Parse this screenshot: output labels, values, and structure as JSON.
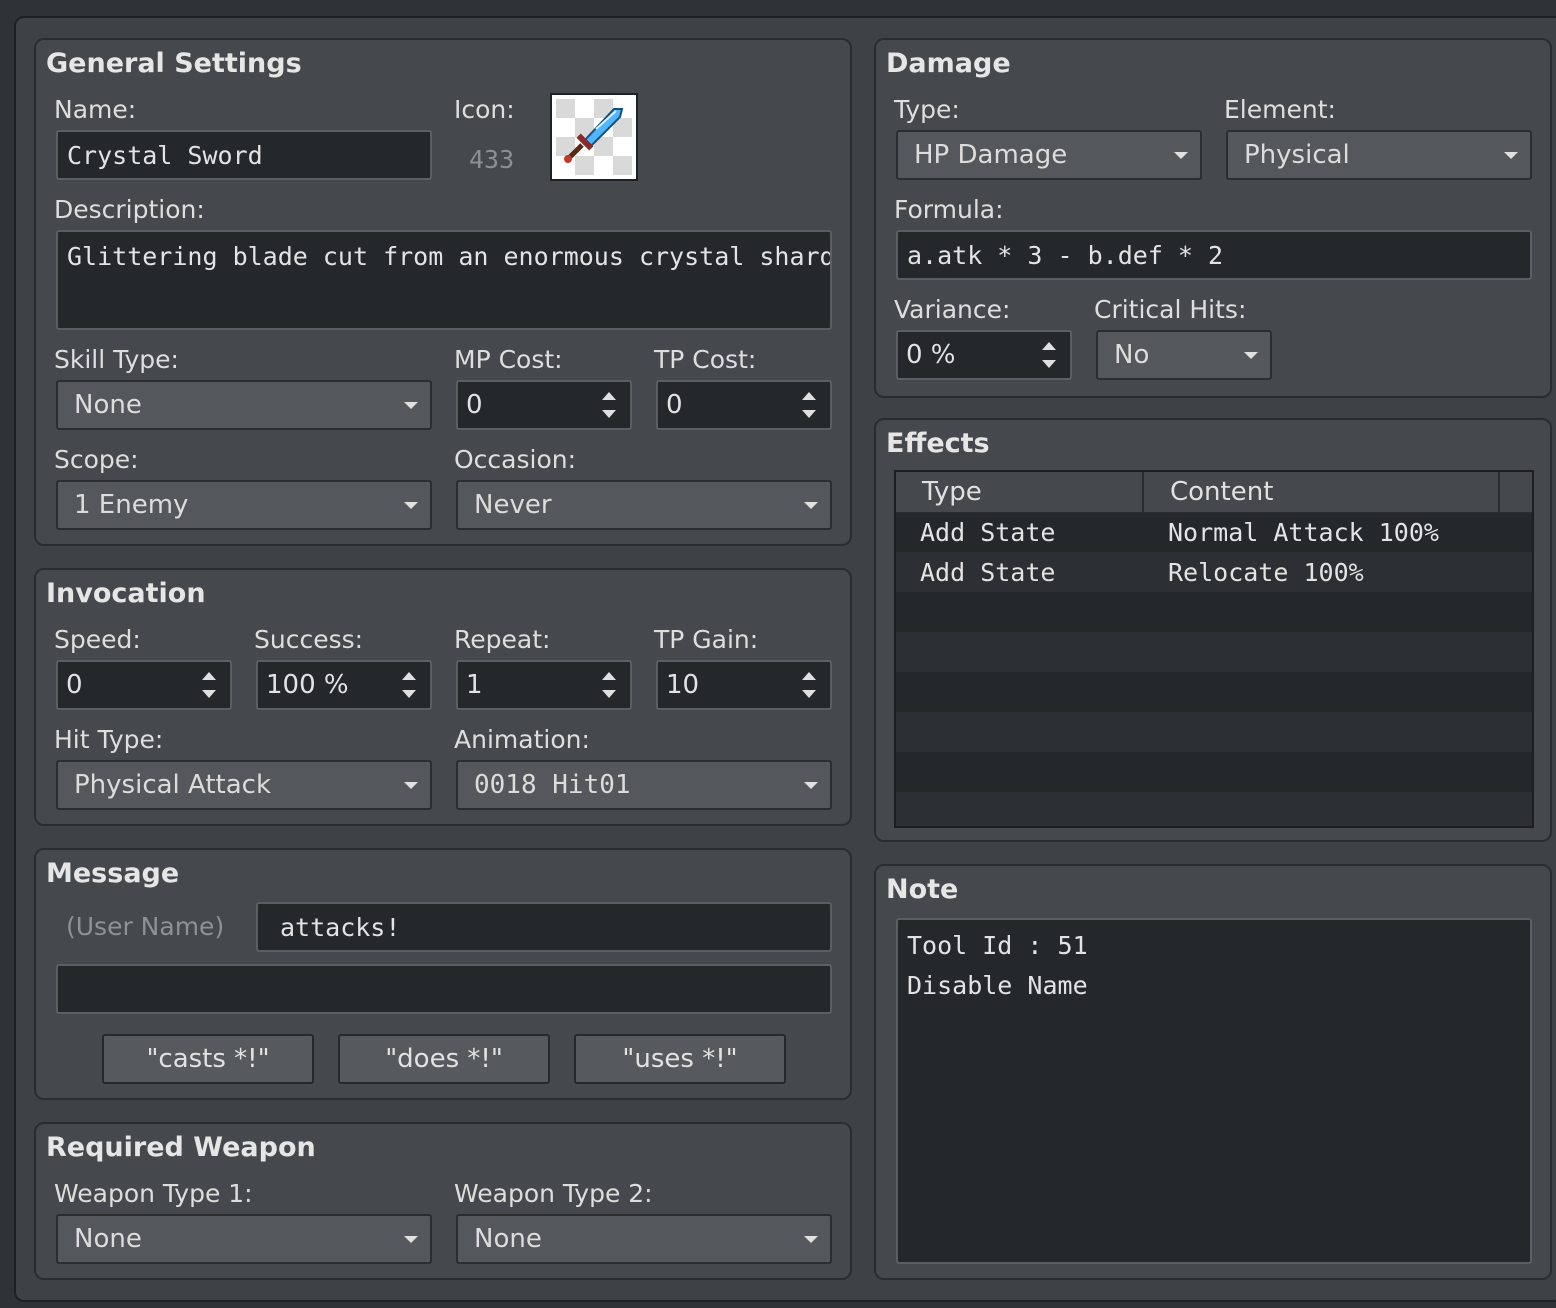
{
  "general": {
    "title": "General Settings",
    "name_label": "Name:",
    "name_value": "Crystal Sword",
    "icon_label": "Icon:",
    "icon_index": "433",
    "icon_name": "sword-icon",
    "description_label": "Description:",
    "description_value": "Glittering blade cut from an enormous crystal shard.",
    "skill_type_label": "Skill Type:",
    "skill_type_value": "None",
    "mp_cost_label": "MP Cost:",
    "mp_cost_value": "0",
    "tp_cost_label": "TP Cost:",
    "tp_cost_value": "0",
    "scope_label": "Scope:",
    "scope_value": "1 Enemy",
    "occasion_label": "Occasion:",
    "occasion_value": "Never"
  },
  "invocation": {
    "title": "Invocation",
    "speed_label": "Speed:",
    "speed_value": "0",
    "success_label": "Success:",
    "success_value": "100 %",
    "repeat_label": "Repeat:",
    "repeat_value": "1",
    "tp_gain_label": "TP Gain:",
    "tp_gain_value": "10",
    "hit_type_label": "Hit Type:",
    "hit_type_value": "Physical Attack",
    "animation_label": "Animation:",
    "animation_value": "0018 Hit01"
  },
  "message": {
    "title": "Message",
    "user_name_label": "(User Name)",
    "line1_value": "attacks!",
    "line2_value": "",
    "buttons": [
      "\"casts *!\"",
      "\"does *!\"",
      "\"uses *!\""
    ]
  },
  "required_weapon": {
    "title": "Required Weapon",
    "type1_label": "Weapon Type 1:",
    "type1_value": "None",
    "type2_label": "Weapon Type 2:",
    "type2_value": "None"
  },
  "damage": {
    "title": "Damage",
    "type_label": "Type:",
    "type_value": "HP Damage",
    "element_label": "Element:",
    "element_value": "Physical",
    "formula_label": "Formula:",
    "formula_value": "a.atk * 3 - b.def * 2",
    "variance_label": "Variance:",
    "variance_value": "0 %",
    "critical_label": "Critical Hits:",
    "critical_value": "No"
  },
  "effects": {
    "title": "Effects",
    "columns": [
      "Type",
      "Content"
    ],
    "rows": [
      {
        "type": "Add State",
        "content": "Normal Attack 100%"
      },
      {
        "type": "Add State",
        "content": "Relocate 100%"
      }
    ]
  },
  "note": {
    "title": "Note",
    "lines": [
      "Tool Id : 51",
      "Disable Name"
    ]
  }
}
